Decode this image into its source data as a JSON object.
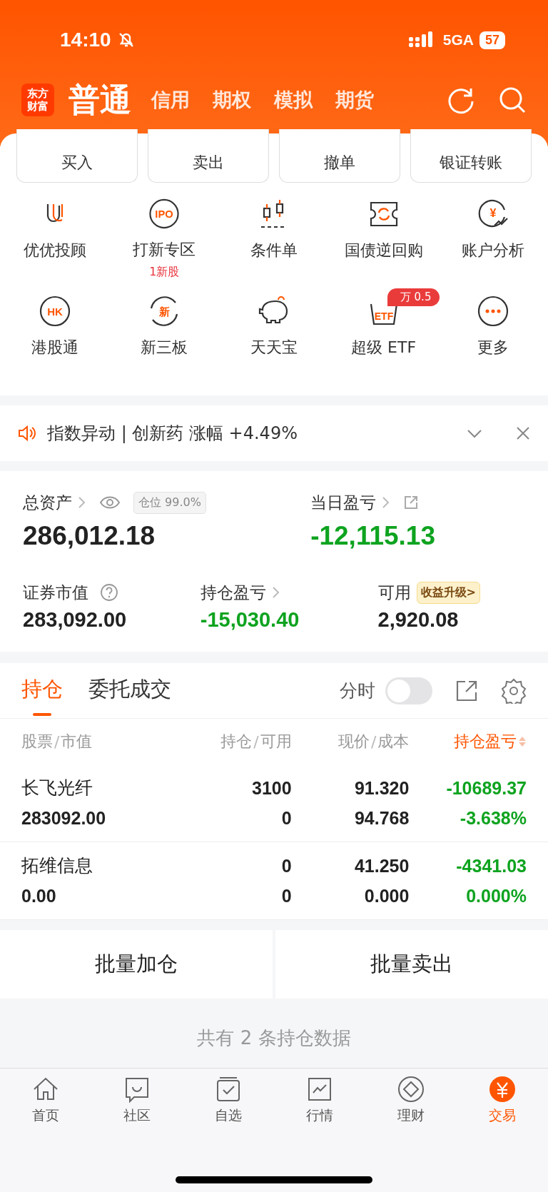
{
  "status_bar": {
    "time": "14:10",
    "network": "5GA",
    "battery": "57",
    "silent": true
  },
  "header": {
    "logo": "东方财富",
    "tabs": [
      {
        "label": "普通",
        "selected": true
      },
      {
        "label": "信用",
        "selected": false
      },
      {
        "label": "期权",
        "selected": false
      },
      {
        "label": "模拟",
        "selected": false
      },
      {
        "label": "期货",
        "selected": false
      }
    ]
  },
  "quick_actions": [
    {
      "label": "买入"
    },
    {
      "label": "卖出"
    },
    {
      "label": "撤单"
    },
    {
      "label": "银证转账"
    }
  ],
  "services": [
    {
      "kind": "advisor",
      "label": "优优投顾"
    },
    {
      "kind": "ipo",
      "label": "打新专区",
      "icon_text": "IPO",
      "note": "1新股"
    },
    {
      "kind": "candles",
      "label": "条件单"
    },
    {
      "kind": "ticket",
      "label": "国债逆回购"
    },
    {
      "kind": "yen",
      "label": "账户分析",
      "icon_text": "¥"
    },
    {
      "kind": "circle",
      "label": "港股通",
      "icon_text": "HK"
    },
    {
      "kind": "cycle",
      "label": "新三板",
      "icon_text": "新"
    },
    {
      "kind": "pig",
      "label": "天天宝"
    },
    {
      "kind": "basket",
      "label": "超级 ETF",
      "icon_text": "ETF",
      "badge": "万 0.5"
    },
    {
      "kind": "more",
      "label": "更多"
    }
  ],
  "notice": {
    "text": "指数异动 | 创新药 涨幅 +4.49%"
  },
  "assets": {
    "total_label": "总资产",
    "position_tag": "仓位 99.0%",
    "total": "286,012.18",
    "daily_label": "当日盈亏",
    "daily": "-12,115.13",
    "market_label": "证券市值",
    "market": "283,092.00",
    "holding_label": "持仓盈亏",
    "holding": "-15,030.40",
    "available_label": "可用",
    "upgrade": "收益升级>",
    "available": "2,920.08"
  },
  "positions": {
    "tabs": [
      {
        "label": "持仓",
        "selected": true
      },
      {
        "label": "委托成交",
        "selected": false
      }
    ],
    "intraday_label": "分时",
    "intraday_on": false,
    "columns": [
      {
        "main": "股票",
        "sep": "/",
        "sub": "市值"
      },
      {
        "main": "持仓",
        "sep": "/",
        "sub": "可用"
      },
      {
        "main": "现价",
        "sep": "/",
        "sub": "成本"
      },
      {
        "main": "持仓盈亏",
        "sorted": true
      }
    ],
    "rows": [
      {
        "name": "长飞光纤",
        "value": "283092.00",
        "holding": "3100",
        "available": "0",
        "price": "91.320",
        "cost": "94.768",
        "pnl": "-10689.37",
        "pnl_pct": "-3.638%"
      },
      {
        "name": "拓维信息",
        "value": "0.00",
        "holding": "0",
        "available": "0",
        "price": "41.250",
        "cost": "0.000",
        "pnl": "-4341.03",
        "pnl_pct": "0.000%"
      }
    ]
  },
  "batch_buttons": [
    "批量加仓",
    "批量卖出"
  ],
  "footer_text": "共有 2 条持仓数据",
  "nav": [
    {
      "kind": "home",
      "label": "首页",
      "selected": false
    },
    {
      "kind": "chat",
      "label": "社区",
      "selected": false
    },
    {
      "kind": "check",
      "label": "自选",
      "selected": false
    },
    {
      "kind": "chart",
      "label": "行情",
      "selected": false
    },
    {
      "kind": "diamond",
      "label": "理财",
      "selected": false
    },
    {
      "kind": "yen",
      "label": "交易",
      "selected": true
    }
  ]
}
